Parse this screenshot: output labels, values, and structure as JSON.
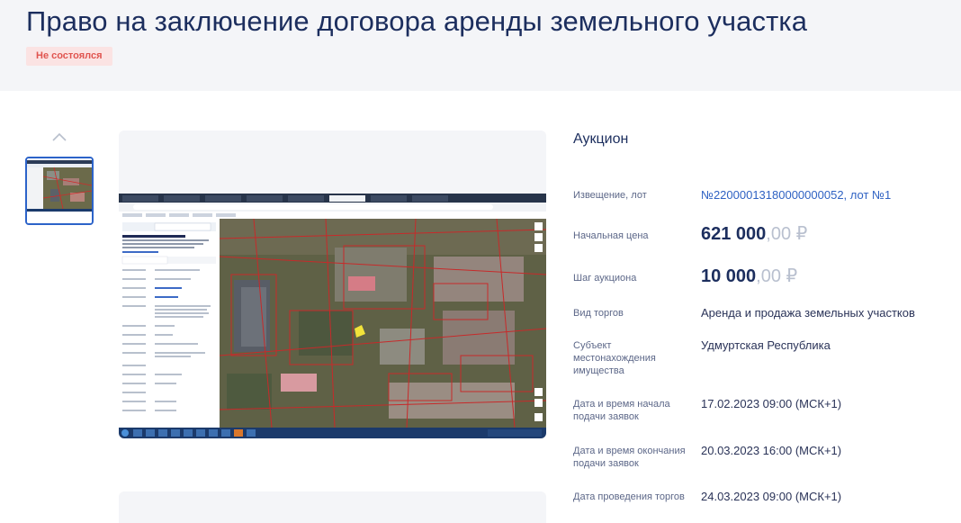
{
  "header": {
    "title": "Право на заключение договора аренды земельного участка",
    "status": "Не состоялся",
    "status_color": "#e0544f"
  },
  "gallery": {
    "prev_icon": "chevron-up-icon",
    "thumbnail": "map-screenshot-thumbnail",
    "image": "cadastral-map-screenshot"
  },
  "details": {
    "auction_type": "Аукцион",
    "notice": {
      "label": "Извещение, лот",
      "value": "№22000013180000000052, лот №1"
    },
    "start_price": {
      "label": "Начальная цена",
      "amount": "621 000",
      "cents": ",00 ₽"
    },
    "step": {
      "label": "Шаг аукциона",
      "amount": "10 000",
      "cents": ",00 ₽"
    },
    "trade_type": {
      "label": "Вид торгов",
      "value": "Аренда и продажа земельных участков"
    },
    "subject": {
      "label": "Субъект местонахождения имущества",
      "value": "Удмуртская Республика"
    },
    "start_date": {
      "label": "Дата и время начала подачи заявок",
      "value": "17.02.2023 09:00 (МСК+1)"
    },
    "end_date": {
      "label": "Дата и время окончания подачи заявок",
      "value": "20.03.2023 16:00 (МСК+1)"
    },
    "auction_date": {
      "label": "Дата проведения торгов",
      "value": "24.03.2023 09:00 (МСК+1)"
    }
  },
  "colors": {
    "accent": "#1c2e5e",
    "link": "#2f62c3",
    "badge_bg": "#fbe3e3"
  }
}
